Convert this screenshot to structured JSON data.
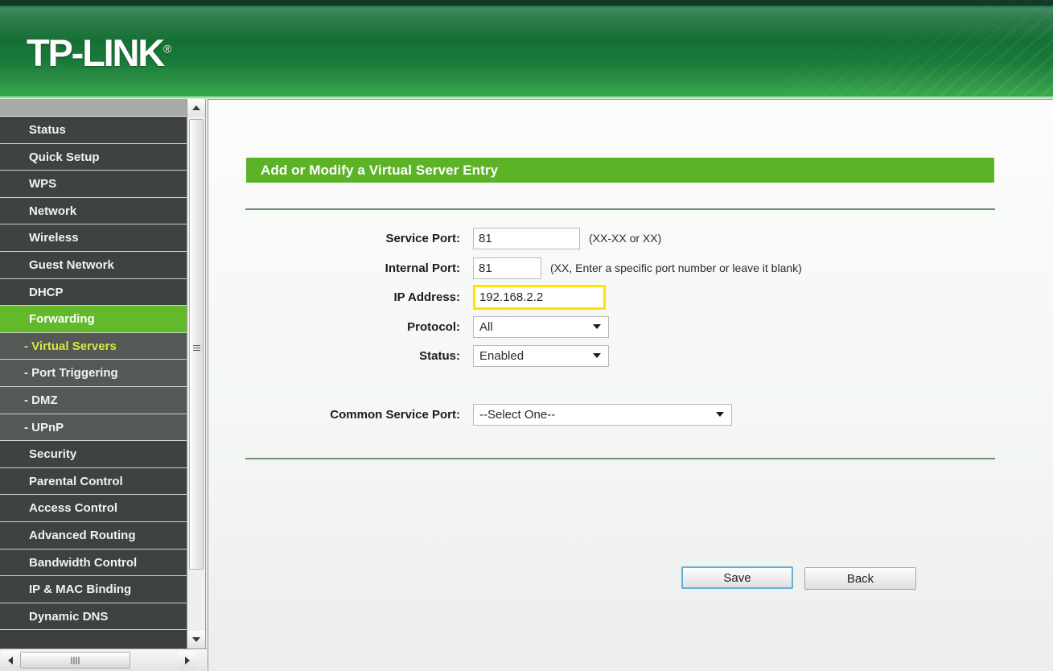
{
  "header": {
    "brand": "TP-LINK",
    "trademark": "®"
  },
  "sidebar": {
    "items": [
      {
        "label": "Status",
        "type": "main",
        "state": "normal"
      },
      {
        "label": "Quick Setup",
        "type": "main",
        "state": "normal"
      },
      {
        "label": "WPS",
        "type": "main",
        "state": "normal"
      },
      {
        "label": "Network",
        "type": "main",
        "state": "normal"
      },
      {
        "label": "Wireless",
        "type": "main",
        "state": "normal"
      },
      {
        "label": "Guest Network",
        "type": "main",
        "state": "normal"
      },
      {
        "label": "DHCP",
        "type": "main",
        "state": "normal"
      },
      {
        "label": "Forwarding",
        "type": "main",
        "state": "active"
      },
      {
        "label": "- Virtual Servers",
        "type": "sub",
        "state": "subactive"
      },
      {
        "label": "- Port Triggering",
        "type": "sub",
        "state": "normal"
      },
      {
        "label": "- DMZ",
        "type": "sub",
        "state": "normal"
      },
      {
        "label": "- UPnP",
        "type": "sub",
        "state": "normal"
      },
      {
        "label": "Security",
        "type": "main",
        "state": "normal"
      },
      {
        "label": "Parental Control",
        "type": "main",
        "state": "normal"
      },
      {
        "label": "Access Control",
        "type": "main",
        "state": "normal"
      },
      {
        "label": "Advanced Routing",
        "type": "main",
        "state": "normal"
      },
      {
        "label": "Bandwidth Control",
        "type": "main",
        "state": "normal"
      },
      {
        "label": "IP & MAC Binding",
        "type": "main",
        "state": "normal"
      },
      {
        "label": "Dynamic DNS",
        "type": "main",
        "state": "normal"
      }
    ]
  },
  "panel": {
    "title": "Add or Modify a Virtual Server Entry"
  },
  "form": {
    "service_port": {
      "label": "Service Port:",
      "value": "81",
      "placeholder": "",
      "hint": "(XX-XX or XX)"
    },
    "internal_port": {
      "label": "Internal Port:",
      "value": "81",
      "placeholder": "",
      "hint": "(XX, Enter a specific port number or leave it blank)"
    },
    "ip_address": {
      "label": "IP Address:",
      "value": "192.168.2.2",
      "placeholder": "",
      "focus_color": "#ffe400"
    },
    "protocol": {
      "label": "Protocol:",
      "value": "All"
    },
    "status": {
      "label": "Status:",
      "value": "Enabled"
    },
    "common_service_port": {
      "label": "Common Service Port:",
      "value": "--Select One--"
    }
  },
  "buttons": {
    "save": "Save",
    "back": "Back"
  },
  "colors": {
    "brand_green": "#5cb327",
    "header_green": "#157034",
    "sidebar_dark": "#3e4240",
    "sidebar_sub": "#555956",
    "sub_active_text": "#d8e83a",
    "focus_yellow": "#ffe400",
    "save_focus_blue": "#62b0d8"
  }
}
